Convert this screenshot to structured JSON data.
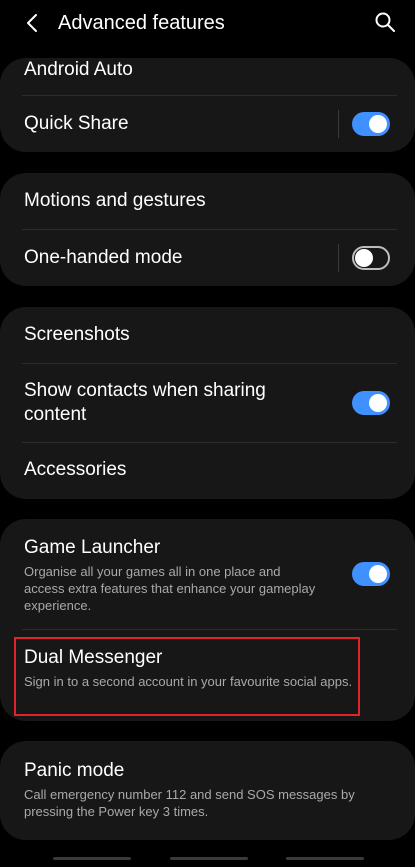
{
  "header": {
    "title": "Advanced features"
  },
  "rows": {
    "android_auto": {
      "title": "Android Auto"
    },
    "quick_share": {
      "title": "Quick Share",
      "enabled": true
    },
    "motions": {
      "title": "Motions and gestures"
    },
    "one_handed": {
      "title": "One-handed mode",
      "enabled": false
    },
    "screenshots": {
      "title": "Screenshots"
    },
    "show_contacts": {
      "title": "Show contacts when sharing content",
      "enabled": true
    },
    "accessories": {
      "title": "Accessories"
    },
    "game_launcher": {
      "title": "Game Launcher",
      "subtitle": "Organise all your games all in one place and access extra features that enhance your gameplay experience.",
      "enabled": true
    },
    "dual_messenger": {
      "title": "Dual Messenger",
      "subtitle": "Sign in to a second account in your favourite social apps."
    },
    "panic_mode": {
      "title": "Panic mode",
      "subtitle": "Call emergency number 112 and send SOS messages by pressing the Power key 3 times."
    }
  },
  "colors": {
    "background": "#000000",
    "card": "#171717",
    "accent": "#3e91ff",
    "highlight": "#e0242c",
    "subtitle": "#a9a9a9"
  },
  "icons": {
    "back": "chevron-left-icon",
    "search": "search-icon"
  }
}
